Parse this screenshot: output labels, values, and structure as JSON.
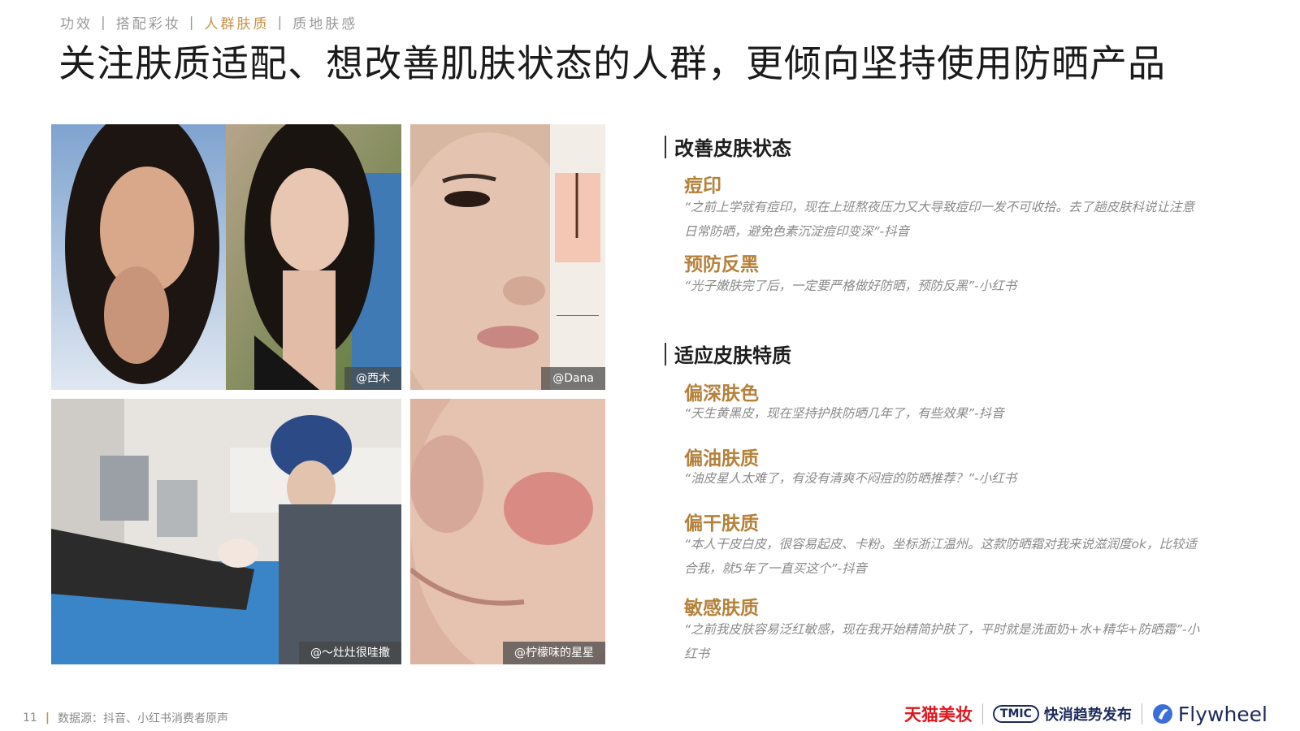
{
  "nav": {
    "items": [
      "功效",
      "搭配彩妆",
      "人群肤质",
      "质地肤感"
    ],
    "active_index": 2
  },
  "title": "关注肤质适配、想改善肌肤状态的人群，更倾向坚持使用防晒产品",
  "photos": [
    {
      "credit": "@西木"
    },
    {
      "credit": "@Dana"
    },
    {
      "credit": "@～灶灶很哇撒"
    },
    {
      "credit": "@柠檬味的星星"
    }
  ],
  "sections": [
    {
      "heading": "改善皮肤状态",
      "items": [
        {
          "label": "痘印",
          "quote": "“之前上学就有痘印，现在上班熬夜压力又大导致痘印一发不可收拾。去了趟皮肤科说让注意日常防晒，避免色素沉淀痘印变深”-抖音"
        },
        {
          "label": "预防反黑",
          "quote": "“光子嫩肤完了后，一定要严格做好防晒，预防反黑”-小红书"
        }
      ]
    },
    {
      "heading": "适应皮肤特质",
      "items": [
        {
          "label": "偏深肤色",
          "quote": "“天生黄黑皮，现在坚持护肤防晒几年了，有些效果”-抖音"
        },
        {
          "label": "偏油肤质",
          "quote": "“油皮星人太难了，有没有清爽不闷痘的防晒推荐？”-小红书"
        },
        {
          "label": "偏干肤质",
          "quote": "“本人干皮白皮，很容易起皮、卡粉。坐标浙江温州。这款防晒霜对我来说滋润度ok，比较适合我，就5年了一直买这个”-抖音"
        },
        {
          "label": "敏感肤质",
          "quote": "“之前我皮肤容易泛红敏感，现在我开始精简护肤了，平时就是洗面奶+水+精华+防晒霜”-小红书"
        }
      ]
    }
  ],
  "footer": {
    "page_number": "11",
    "source": "数据源：抖音、小红书消费者原声",
    "logos": [
      "天猫美妆",
      "TMIC",
      "快消趋势发布",
      "Flywheel"
    ]
  },
  "colors": {
    "accent": "#c9924a",
    "label": "#b5813b",
    "tmall_red": "#e0161e"
  }
}
